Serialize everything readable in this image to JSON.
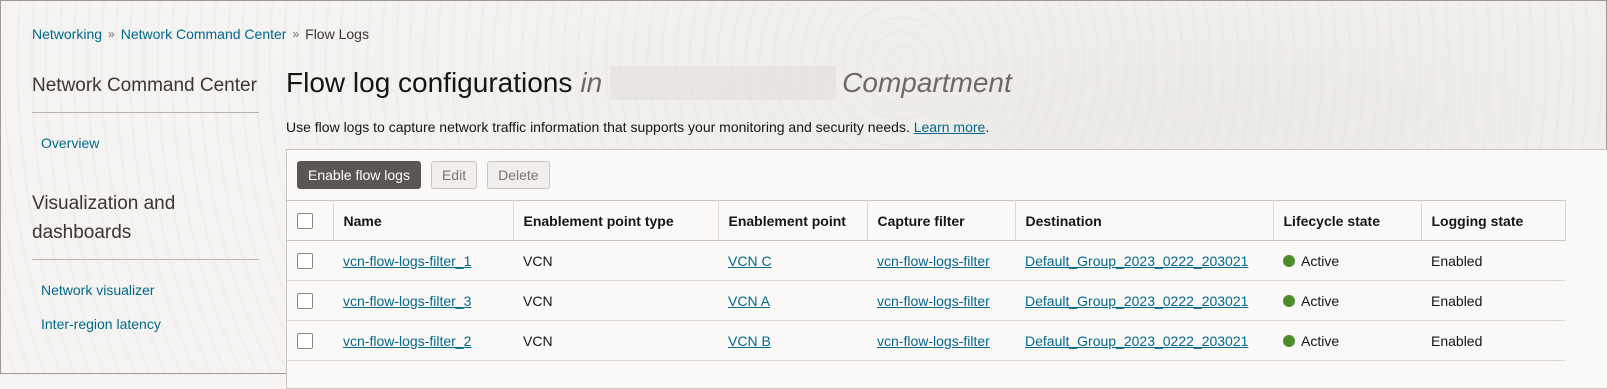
{
  "breadcrumb": {
    "items": [
      "Networking",
      "Network Command Center"
    ],
    "current": "Flow Logs"
  },
  "sidebar": {
    "heading1": "Network Command Center",
    "overview": "Overview",
    "heading2": "Visualization and dashboards",
    "links": [
      "Network visualizer",
      "Inter-region latency"
    ]
  },
  "main": {
    "title": "Flow log configurations",
    "title_in": "in",
    "title_compartment": "Compartment",
    "description": "Use flow logs to capture network traffic information that supports your monitoring and security needs.",
    "learn_more": "Learn more",
    "period": "."
  },
  "toolbar": {
    "enable": "Enable flow logs",
    "edit": "Edit",
    "delete": "Delete"
  },
  "table": {
    "columns": [
      "Name",
      "Enablement point type",
      "Enablement point",
      "Capture filter",
      "Destination",
      "Lifecycle state",
      "Logging state"
    ],
    "rows": [
      {
        "name": "vcn-flow-logs-filter_1",
        "type": "VCN",
        "point": "VCN C",
        "filter": "vcn-flow-logs-filter",
        "destination": "Default_Group_2023_0222_203021",
        "lifecycle": "Active",
        "logging": "Enabled"
      },
      {
        "name": "vcn-flow-logs-filter_3",
        "type": "VCN",
        "point": "VCN A",
        "filter": "vcn-flow-logs-filter",
        "destination": "Default_Group_2023_0222_203021",
        "lifecycle": "Active",
        "logging": "Enabled"
      },
      {
        "name": "vcn-flow-logs-filter_2",
        "type": "VCN",
        "point": "VCN B",
        "filter": "vcn-flow-logs-filter",
        "destination": "Default_Group_2023_0222_203021",
        "lifecycle": "Active",
        "logging": "Enabled"
      }
    ]
  },
  "colors": {
    "link": "#00688c",
    "active_dot": "#4e8c2a",
    "primary_button": "#5b5652"
  },
  "icons": {
    "breadcrumb_separator": "double-chevron-right-icon",
    "status": "status-dot-icon"
  }
}
